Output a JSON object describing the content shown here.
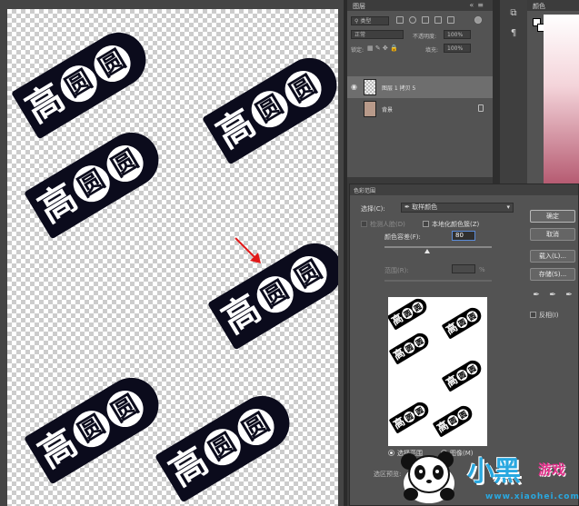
{
  "canvas": {
    "stamp_chars": [
      "高",
      "圆",
      "圆"
    ]
  },
  "layers_panel": {
    "title": "图层",
    "filter_label": "类型",
    "blend_mode": "正常",
    "opacity_label": "不透明度:",
    "opacity_value": "100%",
    "lock_label": "锁定:",
    "fill_label": "填充:",
    "fill_value": "100%",
    "layers": [
      {
        "name": "图层 1 拷贝 5",
        "selected": true
      },
      {
        "name": "背景",
        "selected": false
      }
    ]
  },
  "color_panel": {
    "title": "颜色",
    "accent": "#b05068"
  },
  "color_range_dialog": {
    "title": "色彩范围",
    "select_label": "选择(C):",
    "select_value": "取样颜色",
    "detect_faces_label": "检测人脸(D)",
    "localized_label": "本地化颜色簇(Z)",
    "fuzziness_label": "颜色容差(F):",
    "fuzziness_value": "80",
    "range_label": "范围(R):",
    "range_unit": "%",
    "ok_button": "确定",
    "cancel_button": "取消",
    "load_button": "载入(L)...",
    "save_button": "存储(S)...",
    "invert_label": "反相(I)",
    "radio_selection_label": "选择范围",
    "radio_image_label": "图像(M)",
    "selection_preview_label": "选区预览:",
    "preview_chars": [
      "高",
      "圆",
      "圆"
    ]
  },
  "watermark": {
    "title": "小黑",
    "subtitle": "游戏",
    "url": "www.xiaohei.com"
  }
}
